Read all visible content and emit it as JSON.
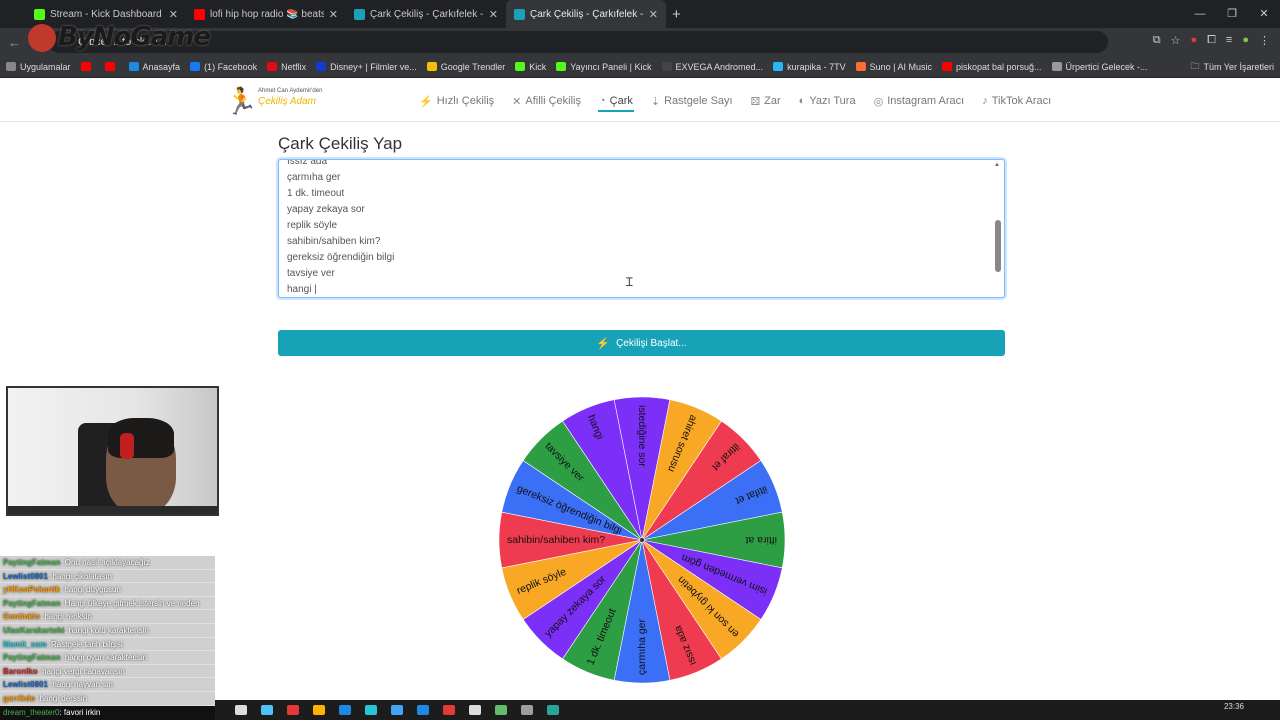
{
  "browser": {
    "tabs": [
      {
        "title": "Stream - Kick Dashboard",
        "color": "#53fc18",
        "active": false
      },
      {
        "title": "lofi hip hop radio 📚 beats",
        "color": "#ff0000",
        "active": false
      },
      {
        "title": "Çark Çekiliş - Çarkıfelek - Hızlı Ç",
        "color": "#17a2b8",
        "active": false
      },
      {
        "title": "Çark Çekiliş - Çarkıfelek - Hızlı Ç",
        "color": "#17a2b8",
        "active": true
      }
    ],
    "overlay_text": "ByNoGame",
    "address_partial": "C     bce. ..   to    ck   .e k",
    "bookmarks": [
      {
        "label": "Uygulamalar",
        "color": "#888"
      },
      {
        "label": "",
        "color": "#ff0000"
      },
      {
        "label": "",
        "color": "#ff0000"
      },
      {
        "label": "Anasayfa",
        "color": "#1e88e5"
      },
      {
        "label": "(1) Facebook",
        "color": "#1877f2"
      },
      {
        "label": "Netflix",
        "color": "#e50914"
      },
      {
        "label": "Disney+ | Filmler ve...",
        "color": "#113ccf"
      },
      {
        "label": "Google Trendler",
        "color": "#fbbc05"
      },
      {
        "label": "Kick",
        "color": "#53fc18"
      },
      {
        "label": "Yayıncı Paneli | Kick",
        "color": "#53fc18"
      },
      {
        "label": "EXVEGA Andromed...",
        "color": "#444"
      },
      {
        "label": "kurapika - 7TV",
        "color": "#29b6f6"
      },
      {
        "label": "Suno | AI Music",
        "color": "#ff6b35"
      },
      {
        "label": "piskopat bal porsuğ...",
        "color": "#ff0000"
      },
      {
        "label": "Ürpertici Gelecek -...",
        "color": "#999"
      }
    ],
    "bookmarks_right": "Tüm Yer İşaretleri"
  },
  "site": {
    "brand_line1": "Ahmet Can Aydemir'den",
    "brand_line2": "Çekiliş Adam",
    "nav": [
      {
        "icon": "⚡",
        "label": "Hızlı Çekiliş",
        "active": false
      },
      {
        "icon": "✕",
        "label": "Afilli Çekiliş",
        "active": false
      },
      {
        "icon": "◔",
        "label": "Çark",
        "active": true
      },
      {
        "icon": "⇣",
        "label": "Rastgele Sayı",
        "active": false
      },
      {
        "icon": "⚄",
        "label": "Zar",
        "active": false
      },
      {
        "icon": "◐",
        "label": "Yazı Tura",
        "active": false
      },
      {
        "icon": "◎",
        "label": "Instagram Aracı",
        "active": false
      },
      {
        "icon": "♪",
        "label": "TikTok Aracı",
        "active": false
      }
    ],
    "page_title": "Çark Çekiliş Yap",
    "textarea_lines": [
      "ıssız ada",
      "çarmıha ger",
      "1 dk. timeout",
      "yapay zekaya sor",
      "replik söyle",
      "sahibin/sahiben kim?",
      "gereksiz öğrendiğin bilgi",
      "tavsiye ver",
      "hangi |"
    ],
    "start_button": "Çekilişi Başlat..."
  },
  "wheel": {
    "segments": [
      {
        "label": "istediğine sor",
        "color": "#7b2ff7"
      },
      {
        "label": "ahiret sorusu",
        "color": "#f9a825"
      },
      {
        "label": "iltiraf et",
        "color": "#ef3b4f"
      },
      {
        "label": "iltifat et",
        "color": "#3b6ff5"
      },
      {
        "label": "iftira at",
        "color": "#2e9e44"
      },
      {
        "label": "isim vermeden göm",
        "color": "#7b2ff7"
      },
      {
        "label": "en son ki gıybetin",
        "color": "#f9a825"
      },
      {
        "label": "ıssız ada",
        "color": "#ef3b4f"
      },
      {
        "label": "çarmıha ger",
        "color": "#3b6ff5"
      },
      {
        "label": "1 dk. timeout",
        "color": "#2e9e44"
      },
      {
        "label": "yapay zekaya sor",
        "color": "#7b2ff7"
      },
      {
        "label": "replik söyle",
        "color": "#f9a825"
      },
      {
        "label": "sahibin/sahiben kim?",
        "color": "#ef3b4f"
      },
      {
        "label": "gereksiz öğrendiğin bilgi",
        "color": "#3b6ff5"
      },
      {
        "label": "tavsiye ver",
        "color": "#2e9e44"
      },
      {
        "label": "hangi",
        "color": "#7b2ff7"
      }
    ]
  },
  "chat": {
    "messages": [
      {
        "user": "PaytingFatman",
        "text": ": Onu nasıl açıklayacağız",
        "color": "#4caf50"
      },
      {
        "user": "Lewlist0801",
        "text": ": hangi çikolatasın",
        "color": "#1565c0"
      },
      {
        "user": "yHKonPekartik",
        "text": ": hangi duygusun",
        "color": "#ff9800"
      },
      {
        "user": "PaytingFatman",
        "text": ": Hangi ülkeye gitmek istersin ve neden",
        "color": "#4caf50"
      },
      {
        "user": "Gentinklo",
        "text": ": hangi renksin",
        "color": "#ff9800"
      },
      {
        "user": "UlasKarakartohi",
        "text": ": hangi kötü karakterisin",
        "color": "#4caf50"
      },
      {
        "user": "Mamit_sam",
        "text": ": Rastgele tarih bilgisi",
        "color": "#26c6da"
      },
      {
        "user": "PaytingFatman",
        "text": ": hangi oyun karakterisin",
        "color": "#4caf50"
      },
      {
        "user": "Baronlko",
        "text": ": hangi vergi canavarısın",
        "color": "#c62828"
      },
      {
        "user": "Lewlist0801",
        "text": ": hangi hayvan sın",
        "color": "#1565c0"
      },
      {
        "user": "garrikdo",
        "text": ": hangi derssin",
        "color": "#ff9800"
      }
    ],
    "last_message": {
      "user": "dream_theater0",
      "text": ": favori irkin"
    }
  },
  "taskbar": {
    "time": "23:36",
    "date": "",
    "icon_colors": [
      "#ddd",
      "#4fc3f7",
      "#e53935",
      "#ffb300",
      "#1e88e5",
      "#26c6da",
      "#42a5f5",
      "#1e88e5",
      "#e53935",
      "#ddd",
      "#66bb6a",
      "#9e9e9e",
      "#26a69a"
    ]
  }
}
